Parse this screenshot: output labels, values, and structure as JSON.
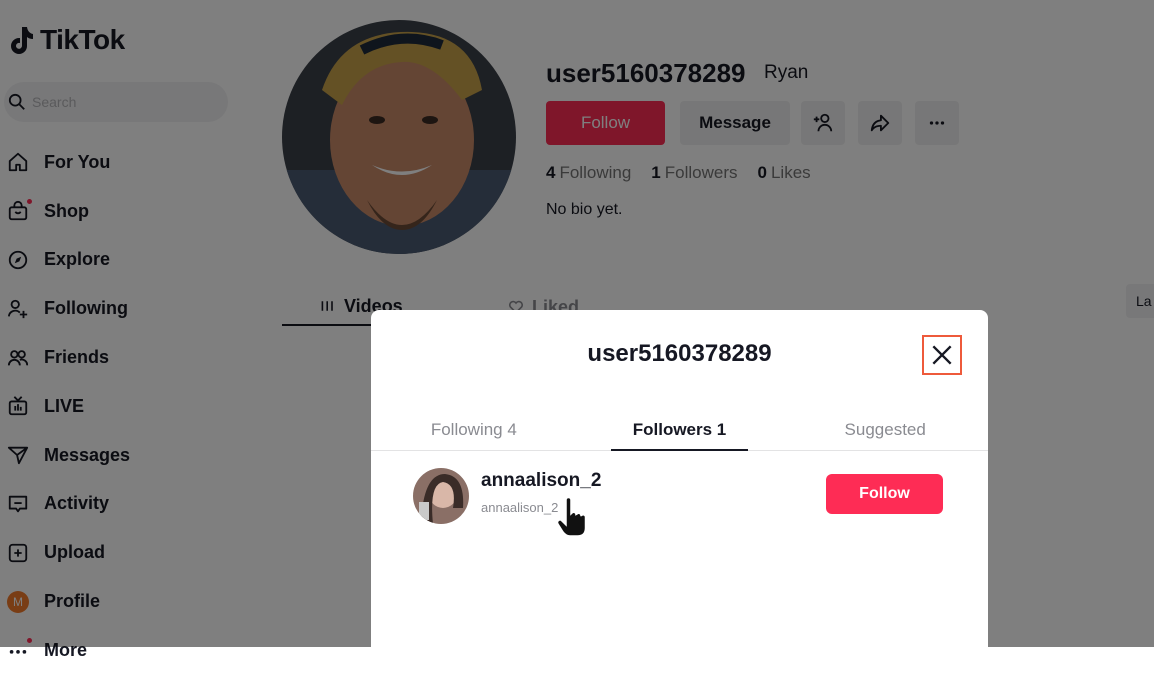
{
  "sidebar": {
    "logo_text": "TikTok",
    "search_placeholder": "Search",
    "items": [
      {
        "label": "For You",
        "icon": "home-icon"
      },
      {
        "label": "Shop",
        "icon": "shop-bag-icon"
      },
      {
        "label": "Explore",
        "icon": "compass-icon"
      },
      {
        "label": "Following",
        "icon": "person-plus-icon"
      },
      {
        "label": "Friends",
        "icon": "friends-icon"
      },
      {
        "label": "LIVE",
        "icon": "live-tv-icon"
      },
      {
        "label": "Messages",
        "icon": "send-icon"
      },
      {
        "label": "Activity",
        "icon": "activity-icon"
      },
      {
        "label": "Upload",
        "icon": "upload-plus-icon"
      },
      {
        "label": "Profile",
        "icon": "avatar-icon",
        "avatar_letter": "M"
      },
      {
        "label": "More",
        "icon": "more-dots-icon"
      }
    ]
  },
  "profile": {
    "username": "user5160378289",
    "nickname": "Ryan",
    "follow_label": "Follow",
    "message_label": "Message",
    "stats": {
      "following_count": "4",
      "following_label": "Following",
      "followers_count": "1",
      "followers_label": "Followers",
      "likes_count": "0",
      "likes_label": "Likes"
    },
    "bio": "No bio yet.",
    "tabs": [
      {
        "label": "Videos",
        "icon": "grid-icon"
      },
      {
        "label": "Liked",
        "icon": "heart-icon"
      }
    ],
    "sort_label": "La"
  },
  "modal": {
    "title": "user5160378289",
    "tabs": [
      "Following 4",
      "Followers 1",
      "Suggested"
    ],
    "active_tab": "Followers 1",
    "followers": [
      {
        "name": "annaalison_2",
        "handle": "annaalison_2",
        "follow_label": "Follow"
      }
    ]
  },
  "colors": {
    "accent": "#fe2c55",
    "close_highlight": "#ee5a3b",
    "profile_avatar": "#f37b2a"
  }
}
